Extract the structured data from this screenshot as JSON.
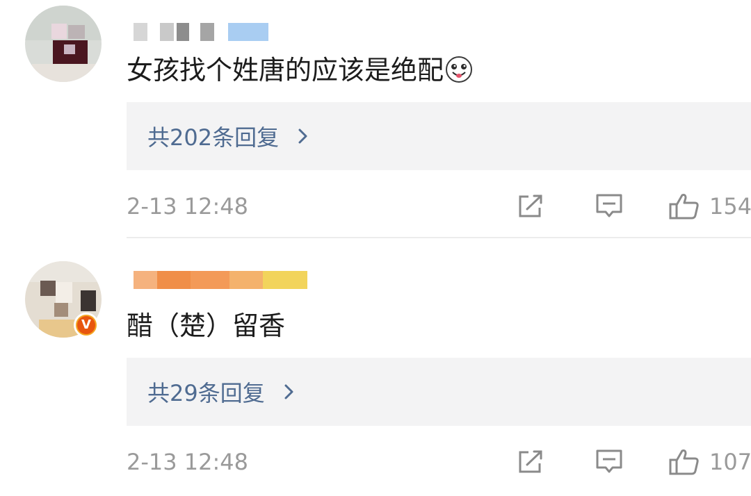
{
  "comments": [
    {
      "text": "女孩找个姓唐的应该是绝配",
      "emoji_icon": "grinning-dog-emoji",
      "replies_label": "共202条回复",
      "time": "2-13 12:48",
      "likes": "154",
      "verified": false
    },
    {
      "text": "醋（楚）留香",
      "replies_label": "共29条回复",
      "time": "2-13 12:48",
      "likes": "107",
      "verified": true,
      "verified_badge": "V"
    }
  ],
  "icons": {
    "share": "share-icon",
    "comment": "comment-icon",
    "like": "thumbs-up-icon",
    "chevron": "chevron-right-icon"
  },
  "colors": {
    "link": "#4f6b91",
    "meta": "#9a9a9a",
    "reply_bg": "#f3f3f4",
    "badge": "#e8560f"
  }
}
